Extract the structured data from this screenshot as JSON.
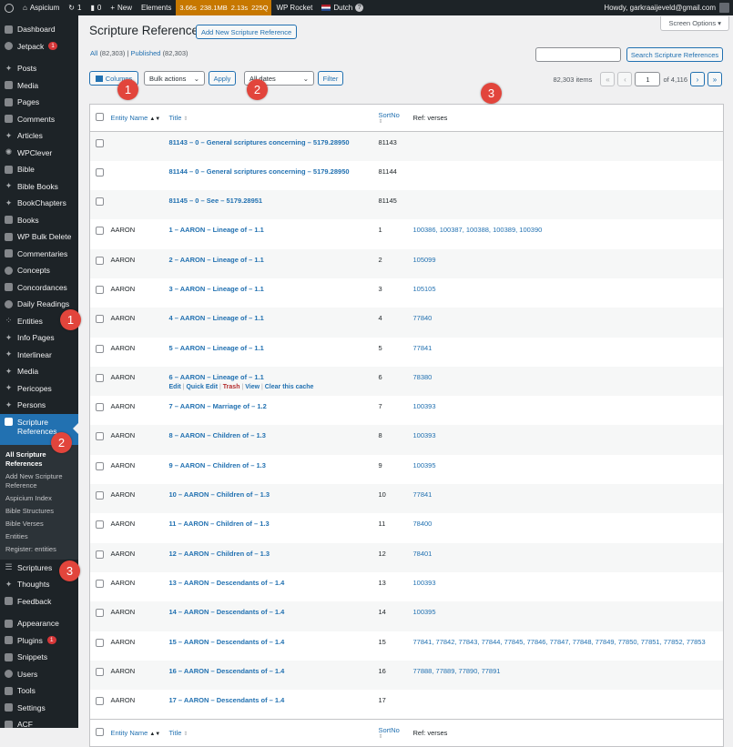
{
  "adminbar": {
    "site": "Aspicium",
    "updates": "1",
    "comments": "0",
    "new": "New",
    "elements": "Elements",
    "perf": [
      "3.66s",
      "238.1MB",
      "2.13s",
      "225Q"
    ],
    "wprocket": "WP Rocket",
    "language": "Dutch",
    "howdy": "Howdy, garkraaijeveld@gmail.com"
  },
  "sidebar": {
    "items": [
      {
        "label": "Dashboard"
      },
      {
        "label": "Jetpack",
        "count": "1"
      },
      {
        "label": "Posts"
      },
      {
        "label": "Media"
      },
      {
        "label": "Pages"
      },
      {
        "label": "Comments"
      },
      {
        "label": "Articles"
      },
      {
        "label": "WPClever"
      },
      {
        "label": "Bible"
      },
      {
        "label": "Bible Books"
      },
      {
        "label": "BookChapters"
      },
      {
        "label": "Books"
      },
      {
        "label": "WP Bulk Delete"
      },
      {
        "label": "Commentaries"
      },
      {
        "label": "Concepts"
      },
      {
        "label": "Concordances"
      },
      {
        "label": "Daily Readings"
      },
      {
        "label": "Entities"
      },
      {
        "label": "Info Pages"
      },
      {
        "label": "Interlinear"
      },
      {
        "label": "Media"
      },
      {
        "label": "Pericopes"
      },
      {
        "label": "Persons"
      },
      {
        "label": "Scripture References"
      }
    ],
    "submenu": [
      {
        "label": "All Scripture References"
      },
      {
        "label": "Add New Scripture Reference"
      },
      {
        "label": "Aspicium Index"
      },
      {
        "label": "Bible Structures"
      },
      {
        "label": "Bible Verses"
      },
      {
        "label": "Entities"
      },
      {
        "label": "Register: entities"
      }
    ],
    "items2": [
      {
        "label": "Scriptures"
      },
      {
        "label": "Thoughts"
      },
      {
        "label": "Feedback"
      }
    ],
    "items3": [
      {
        "label": "Appearance"
      },
      {
        "label": "Plugins",
        "count": "1"
      },
      {
        "label": "Snippets"
      },
      {
        "label": "Users"
      },
      {
        "label": "Tools"
      },
      {
        "label": "Settings"
      },
      {
        "label": "ACF"
      }
    ]
  },
  "page": {
    "screen_options": "Screen Options",
    "title": "Scripture References",
    "add_new": "Add New Scripture Reference",
    "all_label": "All",
    "all_count": "(82,303)",
    "published_label": "Published",
    "published_count": "(82,303)",
    "search_button": "Search Scripture References",
    "columns_button": "Columns",
    "bulk_actions": "Bulk actions",
    "apply": "Apply",
    "all_dates": "All dates",
    "filter": "Filter",
    "items_count": "82,303 items",
    "current_page": "1",
    "of_pages": "of 4,116"
  },
  "table": {
    "headers": {
      "entity": "Entity Name",
      "title": "Title",
      "sortno": "SortNo",
      "refs": "Ref: verses"
    },
    "row_actions": {
      "edit": "Edit",
      "quick_edit": "Quick Edit",
      "trash": "Trash",
      "view": "View",
      "clear_cache": "Clear this cache"
    },
    "rows": [
      {
        "entity": "",
        "title": "81143 – 0 – General scriptures concerning – 5179.28950",
        "sortno": "81143",
        "refs": ""
      },
      {
        "entity": "",
        "title": "81144 – 0 – General scriptures concerning – 5179.28950",
        "sortno": "81144",
        "refs": ""
      },
      {
        "entity": "",
        "title": "81145 – 0 – See – 5179.28951",
        "sortno": "81145",
        "refs": ""
      },
      {
        "entity": "AARON",
        "title": "1 – AARON – Lineage of – 1.1",
        "sortno": "1",
        "refs": "100386, 100387, 100388, 100389, 100390"
      },
      {
        "entity": "AARON",
        "title": "2 – AARON – Lineage of – 1.1",
        "sortno": "2",
        "refs": "105099"
      },
      {
        "entity": "AARON",
        "title": "3 – AARON – Lineage of – 1.1",
        "sortno": "3",
        "refs": "105105"
      },
      {
        "entity": "AARON",
        "title": "4 – AARON – Lineage of – 1.1",
        "sortno": "4",
        "refs": "77840"
      },
      {
        "entity": "AARON",
        "title": "5 – AARON – Lineage of – 1.1",
        "sortno": "5",
        "refs": "77841"
      },
      {
        "entity": "AARON",
        "title": "6 – AARON – Lineage of – 1.1",
        "sortno": "6",
        "refs": "78380"
      },
      {
        "entity": "AARON",
        "title": "7 – AARON – Marriage of – 1.2",
        "sortno": "7",
        "refs": "100393"
      },
      {
        "entity": "AARON",
        "title": "8 – AARON – Children of – 1.3",
        "sortno": "8",
        "refs": "100393"
      },
      {
        "entity": "AARON",
        "title": "9 – AARON – Children of – 1.3",
        "sortno": "9",
        "refs": "100395"
      },
      {
        "entity": "AARON",
        "title": "10 – AARON – Children of – 1.3",
        "sortno": "10",
        "refs": "77841"
      },
      {
        "entity": "AARON",
        "title": "11 – AARON – Children of – 1.3",
        "sortno": "11",
        "refs": "78400"
      },
      {
        "entity": "AARON",
        "title": "12 – AARON – Children of – 1.3",
        "sortno": "12",
        "refs": "78401"
      },
      {
        "entity": "AARON",
        "title": "13 – AARON – Descendants of – 1.4",
        "sortno": "13",
        "refs": "100393"
      },
      {
        "entity": "AARON",
        "title": "14 – AARON – Descendants of – 1.4",
        "sortno": "14",
        "refs": "100395"
      },
      {
        "entity": "AARON",
        "title": "15 – AARON – Descendants of – 1.4",
        "sortno": "15",
        "refs": "77841, 77842, 77843, 77844, 77845, 77846, 77847, 77848, 77849, 77850, 77851, 77852, 77853"
      },
      {
        "entity": "AARON",
        "title": "16 – AARON – Descendants of – 1.4",
        "sortno": "16",
        "refs": "77888, 77889, 77890, 77891"
      },
      {
        "entity": "AARON",
        "title": "17 – AARON – Descendants of – 1.4",
        "sortno": "17",
        "refs": ""
      }
    ]
  },
  "annotations": [
    "1",
    "2",
    "3"
  ],
  "colors": {
    "accent": "#2271b1",
    "adminbar": "#1d2327",
    "perf": "#c77800",
    "badge": "#e2453c"
  }
}
